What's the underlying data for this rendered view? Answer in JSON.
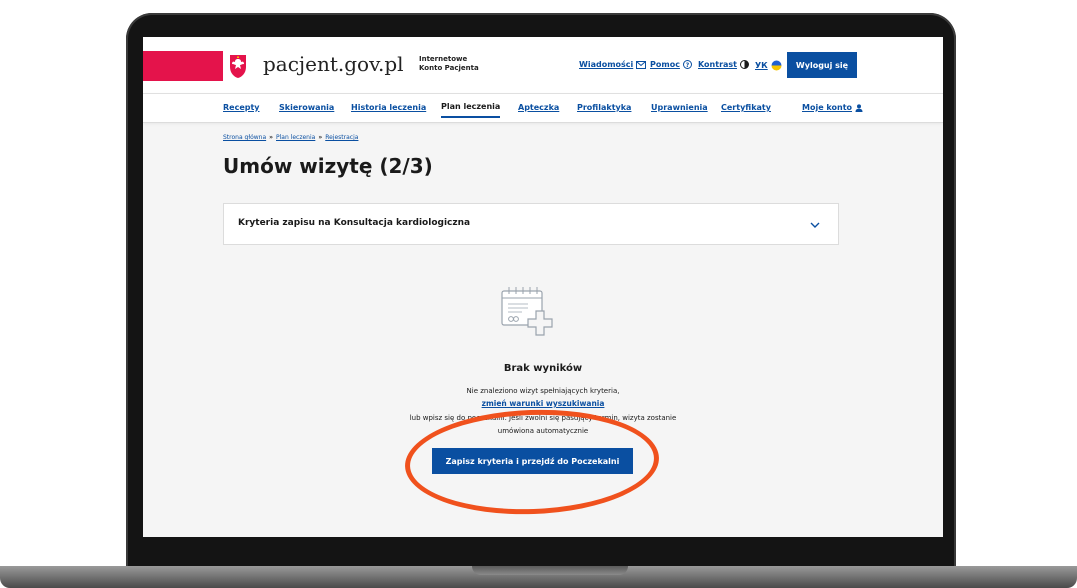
{
  "brand": {
    "name": "pacjent.gov.pl",
    "subtitle_line1": "Internetowe",
    "subtitle_line2": "Konto Pacjenta"
  },
  "header": {
    "links": [
      "Wiadomości",
      "Pomoc",
      "Kontrast",
      "УК"
    ],
    "logout_label": "Wyloguj się"
  },
  "nav": {
    "items": [
      "Recepty",
      "Skierowania",
      "Historia leczenia",
      "Plan leczenia",
      "Apteczka",
      "Profilaktyka",
      "Uprawnienia",
      "Certyfikaty",
      "Moje konto"
    ],
    "active": "Plan leczenia"
  },
  "breadcrumb": [
    "Strona główna",
    "Plan leczenia",
    "Rejestracja"
  ],
  "page_title": "Umów wizytę (2/3)",
  "accordion": {
    "label": "Kryteria zapisu na Konsultacja kardiologiczna"
  },
  "empty_state": {
    "title": "Brak wyników",
    "line1": "Nie znaleziono wizyt spełniających kryteria,",
    "link": "zmień warunki wyszukiwania",
    "line2": "lub wpisz się do poczekalni. Jeśli zwolni się pasujący termin, wizyta zostanie",
    "line3": "umówiona automatycznie",
    "button": "Zapisz kryteria i przejdź do Poczekalni"
  },
  "colors": {
    "primary": "#0a4fa1",
    "brand_red": "#e4134b",
    "highlight": "#f0511d"
  }
}
